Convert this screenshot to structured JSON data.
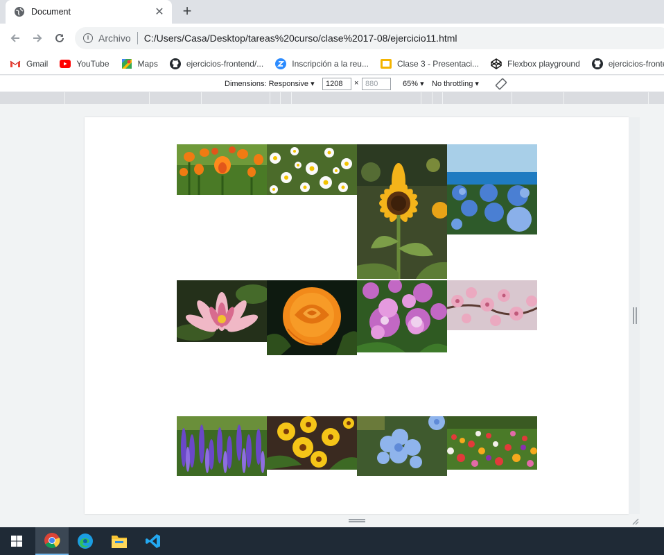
{
  "browser": {
    "tab_title": "Document",
    "url_scheme_label": "Archivo",
    "url": "C:/Users/Casa/Desktop/tareas%20curso/clase%2017-08/ejercicio11.html"
  },
  "bookmarks": [
    {
      "label": "Gmail",
      "icon": "gmail-icon"
    },
    {
      "label": "YouTube",
      "icon": "youtube-icon"
    },
    {
      "label": "Maps",
      "icon": "maps-icon"
    },
    {
      "label": "ejercicios-frontend/...",
      "icon": "github-icon"
    },
    {
      "label": "Inscripción a la reu...",
      "icon": "zoom-icon"
    },
    {
      "label": "Clase 3 - Presentaci...",
      "icon": "slides-icon"
    },
    {
      "label": "Flexbox playground",
      "icon": "codepen-icon"
    },
    {
      "label": "ejercicios-fronten",
      "icon": "github-icon"
    }
  ],
  "device_toolbar": {
    "dimensions_label": "Dimensions: Responsive",
    "width_value": "1208",
    "times": "×",
    "height_value": "880",
    "zoom": "65%",
    "throttling": "No throttling"
  },
  "gallery": {
    "images": [
      {
        "name": "orange-tulips-image"
      },
      {
        "name": "daisies-image"
      },
      {
        "name": "sunflower-image"
      },
      {
        "name": "blue-hydrangeas-image"
      },
      {
        "name": "water-lily-image"
      },
      {
        "name": "orange-rose-image"
      },
      {
        "name": "pink-hydrangea-image"
      },
      {
        "name": "cherry-blossom-image"
      },
      {
        "name": "lavender-salvia-image"
      },
      {
        "name": "yellow-gazania-image"
      },
      {
        "name": "blue-plumbago-image"
      },
      {
        "name": "tulip-field-image"
      }
    ]
  },
  "taskbar": {
    "apps": [
      "windows-start-icon",
      "chrome-icon",
      "edge-icon",
      "file-explorer-icon",
      "vscode-icon"
    ]
  },
  "colors": {
    "chrome_tabstrip": "#dee1e6",
    "taskbar": "#1f2a36"
  }
}
